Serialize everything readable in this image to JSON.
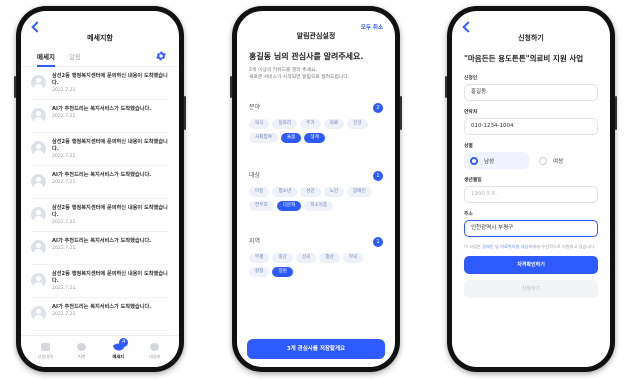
{
  "screen1": {
    "title": "메세지함",
    "tabs": [
      "메세지",
      "알림"
    ],
    "messages": [
      {
        "text": "삼선2동 행정복지센터에 문의하신 내용이 도착했습니다.",
        "date": "2022.7.21."
      },
      {
        "text": "AI가 추천드리는 복지서비스가 도착했습니다.",
        "date": "2022.7.21."
      },
      {
        "text": "삼선2동 행정복지센터에 문의하신 내용이 도착했습니다.",
        "date": "2022.7.21."
      },
      {
        "text": "AI가 추천드리는 복지서비스가 도착했습니다.",
        "date": "2022.7.21."
      },
      {
        "text": "삼선2동 행정복지센터에 문의하신 내용이 도착했습니다.",
        "date": "2022.7.21."
      },
      {
        "text": "AI가 추천드리는 복지서비스가 도착했습니다.",
        "date": "2022.7.21."
      },
      {
        "text": "삼선2동 행정복지센터에 문의하신 내용이 도착했습니다.",
        "date": "2022.7.21."
      },
      {
        "text": "AI가 추천드리는 복지서비스가 도착했습니다.",
        "date": "2022.7.21."
      }
    ],
    "nav": [
      "신청내역",
      "AI봇",
      "메세지",
      "내정보"
    ],
    "nav_badge": "4"
  },
  "screen2": {
    "title": "알림관심설정",
    "header_action": "모두 취소",
    "intro_title": "홍길동 님의 관심사를 알려주세요.",
    "intro_desc_1": "2개 이상의 키워드를 골라 주세요.",
    "intro_desc_2": "새로운 서비스가 시작되면 알림으로 알려드립니다.",
    "sections": [
      {
        "label": "분야",
        "count": "2",
        "chips": [
          {
            "t": "의식",
            "on": false
          },
          {
            "t": "일자리",
            "on": false
          },
          {
            "t": "주거",
            "on": false
          },
          {
            "t": "의료",
            "on": false
          },
          {
            "t": "건강",
            "on": false
          },
          {
            "t": "사회참여",
            "on": false
          },
          {
            "t": "돌봄",
            "on": true
          },
          {
            "t": "생계",
            "on": true
          }
        ]
      },
      {
        "label": "대상",
        "count": "1",
        "chips": [
          {
            "t": "아동",
            "on": false
          },
          {
            "t": "청소년",
            "on": false
          },
          {
            "t": "성인",
            "on": false
          },
          {
            "t": "노인",
            "on": false
          },
          {
            "t": "장애인",
            "on": false
          },
          {
            "t": "한부모",
            "on": false
          },
          {
            "t": "다문화",
            "on": true
          },
          {
            "t": "저소득층",
            "on": false
          }
        ]
      },
      {
        "label": "지역",
        "count": "1",
        "chips": [
          {
            "t": "부평",
            "on": false
          },
          {
            "t": "중산",
            "on": false
          },
          {
            "t": "선곡",
            "on": false
          },
          {
            "t": "청산",
            "on": false
          },
          {
            "t": "부곡",
            "on": false
          },
          {
            "t": "갈정",
            "on": false
          },
          {
            "t": "청원",
            "on": true
          }
        ]
      }
    ],
    "cta": "3개 관심사를 저장할게요"
  },
  "screen3": {
    "title": "신청하기",
    "form_title": "\"마음든든 용도튼튼\"의료비 지원 사업",
    "name_label": "신청인",
    "name_value": "홍길동",
    "phone_label": "연락처",
    "phone_value": "010-1234-1004",
    "gender_label": "성별",
    "gender_male": "남성",
    "gender_female": "여성",
    "birth_label": "생년월일",
    "birth_placeholder": "1990.5.6.",
    "address_label": "주소",
    "address_value": "인천광역시 부평구",
    "notice_pre": "이 사업은 ",
    "notice_hl1": "장애인",
    "notice_mid": " 및 ",
    "notice_hl2": "의료취약층 대상자",
    "notice_post": "에게 우선적으로 지원하고 있습니다.",
    "primary_btn": "자격확인하기",
    "disabled_btn": "신청하기"
  },
  "colors": {
    "accent": "#2e5bff"
  }
}
